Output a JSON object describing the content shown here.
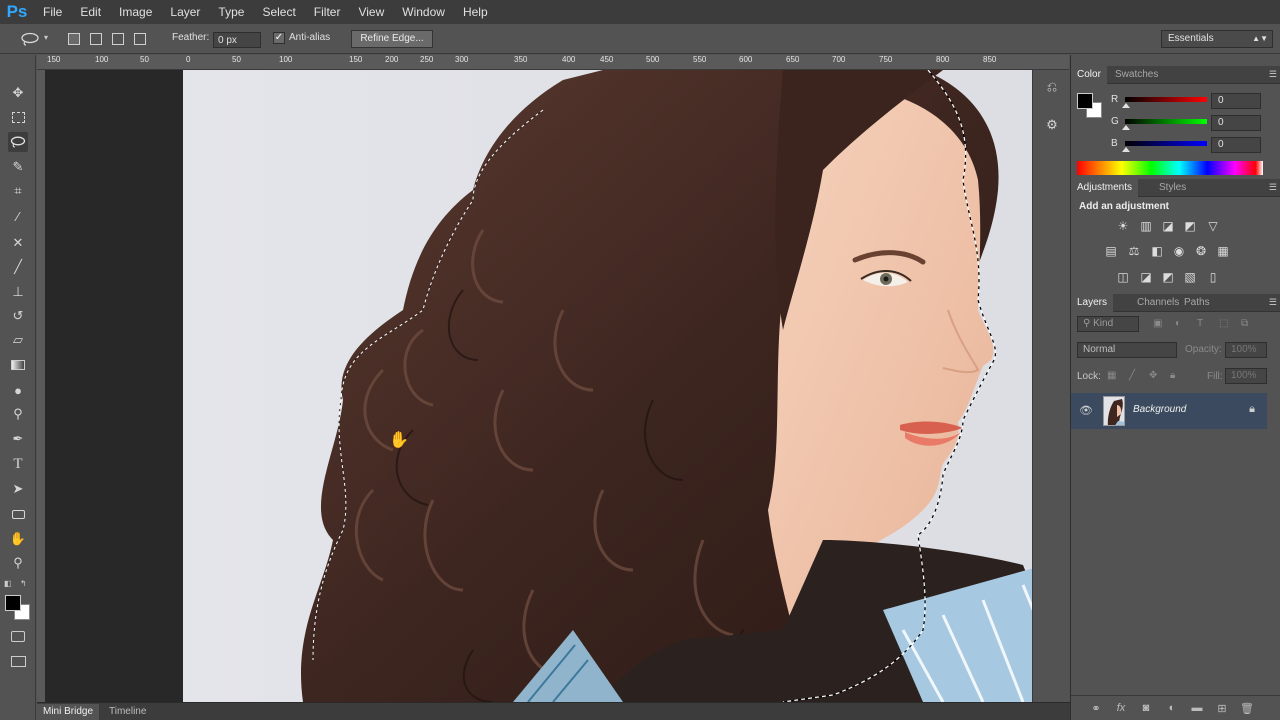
{
  "app": {
    "logo": "Ps"
  },
  "menu": [
    "File",
    "Edit",
    "Image",
    "Layer",
    "Type",
    "Select",
    "Filter",
    "View",
    "Window",
    "Help"
  ],
  "options": {
    "tool_icon": "lasso-icon",
    "feather_label": "Feather:",
    "feather_value": "0 px",
    "antialias_label": "Anti-alias",
    "antialias_checked": true,
    "refine_edge": "Refine Edge...",
    "workspace": "Essentials"
  },
  "ruler": {
    "ticks": [
      "150",
      "100",
      "50",
      "0",
      "50",
      "100",
      "150",
      "200",
      "250",
      "300",
      "350",
      "400",
      "450",
      "500",
      "550",
      "600",
      "650",
      "700",
      "750",
      "800",
      "850"
    ]
  },
  "tools": [
    "move",
    "marquee",
    "lasso",
    "quick-select",
    "crop",
    "eyedropper",
    "healing",
    "brush",
    "clone-stamp",
    "history-brush",
    "eraser",
    "gradient",
    "blur",
    "dodge",
    "pen",
    "type",
    "path-select",
    "rectangle",
    "hand",
    "zoom"
  ],
  "bottom_tabs": [
    "Mini Bridge",
    "Timeline"
  ],
  "color_panel": {
    "tabs": [
      "Color",
      "Swatches"
    ],
    "channels": [
      {
        "label": "R",
        "value": "0",
        "color": "#ff0000"
      },
      {
        "label": "G",
        "value": "0",
        "color": "#00ff00"
      },
      {
        "label": "B",
        "value": "0",
        "color": "#0000ff"
      }
    ]
  },
  "adjustments_panel": {
    "tabs": [
      "Adjustments",
      "Styles"
    ],
    "heading": "Add an adjustment"
  },
  "layers_panel": {
    "tabs": [
      "Layers",
      "Channels",
      "Paths"
    ],
    "filter_kind": "Kind",
    "blend_mode": "Normal",
    "opacity_label": "Opacity:",
    "opacity_value": "100%",
    "lock_label": "Lock:",
    "fill_label": "Fill:",
    "fill_value": "100%",
    "layers": [
      {
        "name": "Background",
        "visible": true,
        "locked": true
      }
    ]
  }
}
